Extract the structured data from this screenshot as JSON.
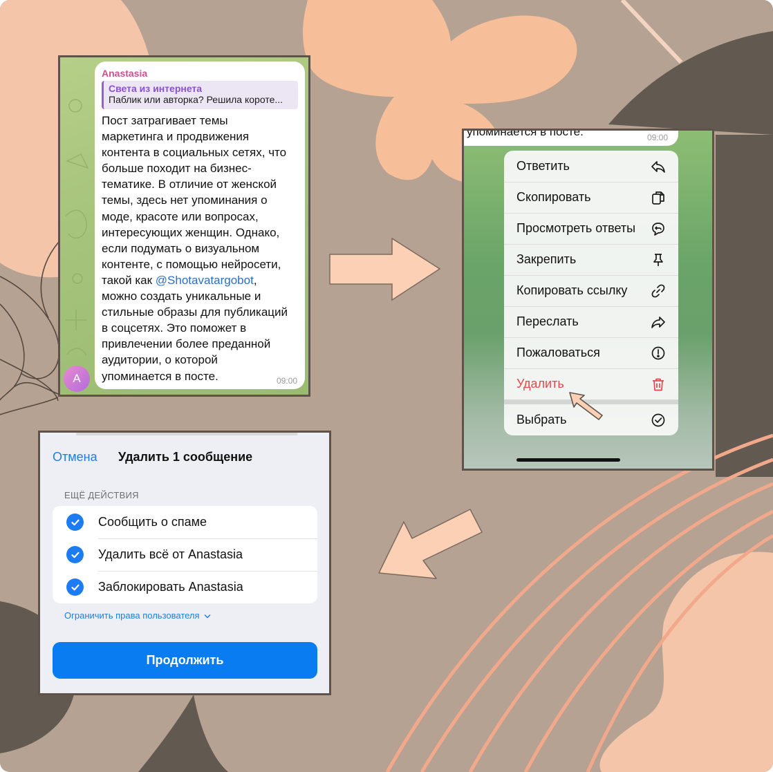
{
  "chat": {
    "sender": "Anastasia",
    "reply_name": "Света из интернета",
    "reply_text": "Паблик или авторка? Решила короте...",
    "message_lines": [
      "Пост затрагивает темы",
      "маркетинга и продвижения",
      "контента в социальных сетях, что",
      "больше походит на бизнес-",
      "тематике. В отличие от женской",
      "темы, здесь нет упоминания о",
      "моде, красоте или вопросах,",
      "интересующих женщин. Однако,",
      "если подумать о визуальном",
      "контенте, с помощью нейросети,"
    ],
    "mention_prefix": "такой как ",
    "mention": "@Shotavatargobot",
    "mention_suffix": ",",
    "message_lines_after": [
      "можно создать уникальные и",
      "стильные образы для публикаций",
      "в соцсетях. Это поможет в",
      "привлечении более преданной",
      "аудитории, о которой",
      "упоминается в посте."
    ],
    "time": "09:00",
    "avatar_letter": "A"
  },
  "menu": {
    "top_text": "упоминается в посте.",
    "top_time": "09:00",
    "items": [
      {
        "label": "Ответить",
        "icon": "reply-icon"
      },
      {
        "label": "Скопировать",
        "icon": "copy-icon"
      },
      {
        "label": "Просмотреть ответы",
        "icon": "replies-icon"
      },
      {
        "label": "Закрепить",
        "icon": "pin-icon"
      },
      {
        "label": "Копировать ссылку",
        "icon": "link-icon"
      },
      {
        "label": "Переслать",
        "icon": "forward-icon"
      },
      {
        "label": "Пожаловаться",
        "icon": "report-icon"
      },
      {
        "label": "Удалить",
        "icon": "trash-icon",
        "danger": true
      }
    ],
    "select_label": "Выбрать",
    "select_icon": "select-check-icon",
    "danger_color": "#e5474b"
  },
  "dialog": {
    "cancel": "Отмена",
    "title": "Удалить 1 сообщение",
    "section": "ЕЩЁ ДЕЙСТВИЯ",
    "options": [
      {
        "label": "Сообщить о спаме",
        "checked": true
      },
      {
        "label": "Удалить всё от Anastasia",
        "checked": true
      },
      {
        "label": "Заблокировать Anastasia",
        "checked": true
      }
    ],
    "restrict": "Ограничить права пользователя",
    "continue": "Продолжить",
    "accent_color": "#0a7cf2"
  }
}
